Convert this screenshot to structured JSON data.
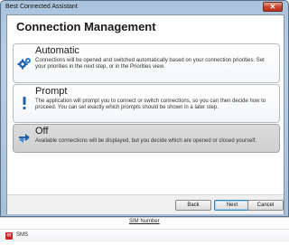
{
  "window": {
    "title": "Best Connected Assistant",
    "close_glyph": "✕"
  },
  "dialog": {
    "heading": "Connection Management",
    "options": [
      {
        "title": "Automatic",
        "description": "Connections will be opened and switched automatically based on your connection priorities. Set your priorities in the next step, or in the Priorities view.",
        "icon": "gears-icon",
        "selected": false
      },
      {
        "title": "Prompt",
        "description": "The application will prompt you to connect or switch connections, so you can then decide how to proceed. You can set exactly which prompts should be shown in a later step.",
        "icon": "exclamation-icon",
        "selected": false
      },
      {
        "title": "Off",
        "description": "Available connections will be displayed, but you decide which are opened or closed yourself.",
        "icon": "arrows-off-icon",
        "selected": true
      }
    ],
    "buttons": {
      "back": "Back",
      "next": "Next",
      "cancel": "Cancel"
    }
  },
  "background_app": {
    "sim_label": "SIM Number",
    "sms_label": "SMS"
  }
}
